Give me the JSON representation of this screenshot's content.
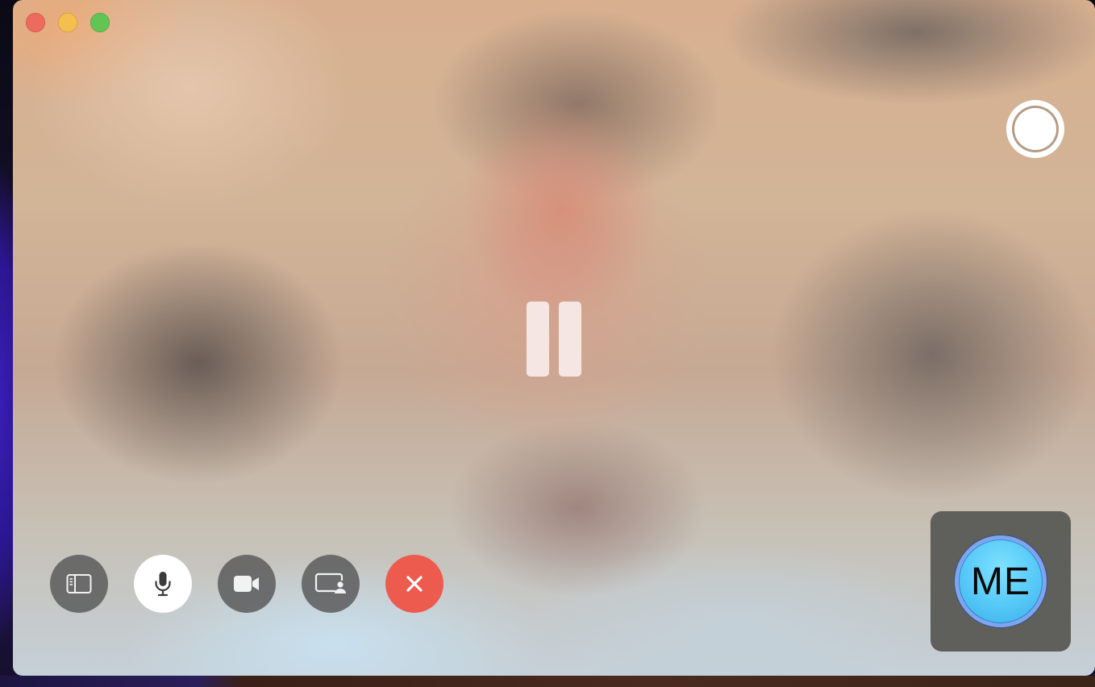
{
  "window": {
    "controls": [
      "close",
      "minimize",
      "zoom"
    ]
  },
  "call_state": "paused",
  "toolbar": {
    "buttons": [
      {
        "id": "sidebar",
        "icon": "sidebar-icon"
      },
      {
        "id": "mute",
        "icon": "microphone-icon",
        "state": "active"
      },
      {
        "id": "video",
        "icon": "video-camera-icon"
      },
      {
        "id": "share-screen",
        "icon": "screen-share-icon"
      },
      {
        "id": "end-call",
        "icon": "close-icon"
      }
    ]
  },
  "record": {
    "icon": "record-icon"
  },
  "self_view": {
    "initials": "ME"
  },
  "colors": {
    "end_call": "#ec5b4e",
    "control_bg": "#5f5f5f",
    "avatar_accent": "#55c8f7"
  }
}
